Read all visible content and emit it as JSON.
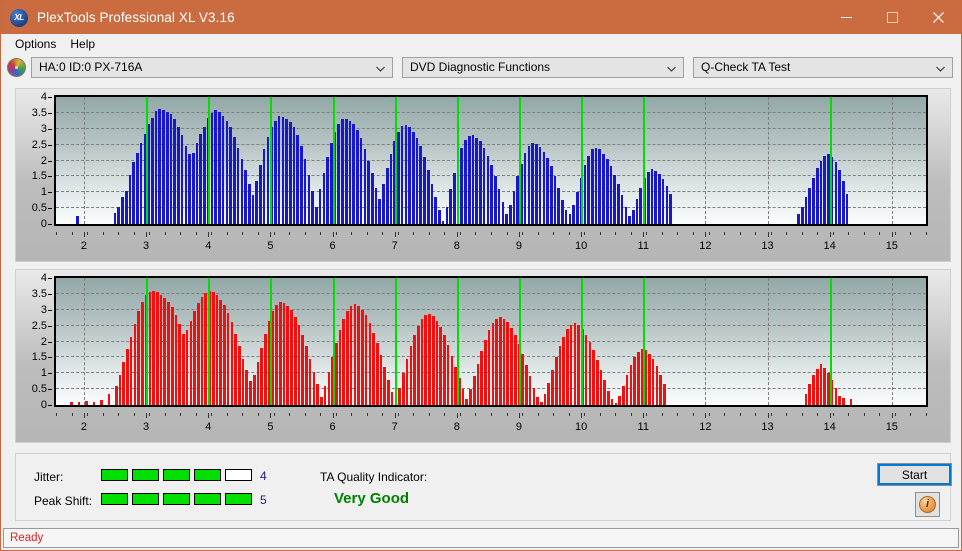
{
  "window": {
    "title": "PlexTools Professional XL V3.16",
    "icon": "xl-logo-icon",
    "minimize_label": "–",
    "maximize_label": "□",
    "close_label": "✕"
  },
  "menubar": {
    "items": [
      {
        "label": "Options"
      },
      {
        "label": "Help"
      }
    ]
  },
  "toolbar": {
    "drive_icon": "disc-icon",
    "drive": {
      "value": "HA:0 ID:0  PX-716A"
    },
    "function": {
      "value": "DVD Diagnostic Functions"
    },
    "test": {
      "value": "Q-Check TA Test"
    }
  },
  "charts": {
    "y_ticks": [
      "4",
      "3.5",
      "3",
      "2.5",
      "2",
      "1.5",
      "1",
      "0.5",
      "0"
    ],
    "x_ticks": [
      "2",
      "3",
      "4",
      "5",
      "6",
      "7",
      "8",
      "9",
      "10",
      "11",
      "12",
      "13",
      "14",
      "15"
    ]
  },
  "chart_data": [
    {
      "type": "bar",
      "name": "jitter-chart",
      "title": "",
      "xlabel": "",
      "ylabel": "",
      "color": "#1818c8",
      "marker_color": "#00e000",
      "xlim": [
        1.55,
        15.55
      ],
      "ylim": [
        0,
        4
      ],
      "grid": true,
      "yticks": [
        0,
        0.5,
        1,
        1.5,
        2,
        2.5,
        3,
        3.5,
        4
      ],
      "xticks": [
        2,
        3,
        4,
        5,
        6,
        7,
        8,
        9,
        10,
        11,
        12,
        13,
        14,
        15
      ],
      "markers": [
        3,
        4,
        5,
        6,
        7,
        8,
        9,
        10,
        11,
        14
      ],
      "x": [
        1.9,
        1.96,
        2.02,
        2.08,
        2.14,
        2.2,
        2.26,
        2.32,
        2.38,
        2.44,
        2.5,
        2.56,
        2.62,
        2.68,
        2.74,
        2.8,
        2.86,
        2.92,
        2.98,
        3.04,
        3.1,
        3.16,
        3.22,
        3.28,
        3.34,
        3.4,
        3.46,
        3.52,
        3.58,
        3.64,
        3.7,
        3.76,
        3.82,
        3.88,
        3.94,
        4.0,
        4.06,
        4.12,
        4.18,
        4.24,
        4.3,
        4.36,
        4.42,
        4.48,
        4.54,
        4.6,
        4.66,
        4.72,
        4.78,
        4.84,
        4.9,
        4.96,
        5.02,
        5.08,
        5.14,
        5.2,
        5.26,
        5.32,
        5.38,
        5.44,
        5.5,
        5.56,
        5.62,
        5.68,
        5.74,
        5.8,
        5.86,
        5.92,
        5.98,
        6.04,
        6.1,
        6.16,
        6.22,
        6.28,
        6.34,
        6.4,
        6.46,
        6.52,
        6.58,
        6.64,
        6.7,
        6.76,
        6.82,
        6.88,
        6.94,
        7.0,
        7.06,
        7.12,
        7.18,
        7.24,
        7.3,
        7.36,
        7.42,
        7.48,
        7.54,
        7.6,
        7.66,
        7.72,
        7.78,
        7.84,
        7.9,
        7.96,
        8.02,
        8.08,
        8.14,
        8.2,
        8.26,
        8.32,
        8.38,
        8.44,
        8.5,
        8.56,
        8.62,
        8.68,
        8.74,
        8.8,
        8.86,
        8.92,
        8.98,
        9.04,
        9.1,
        9.16,
        9.22,
        9.28,
        9.34,
        9.4,
        9.46,
        9.52,
        9.58,
        9.64,
        9.7,
        9.76,
        9.82,
        9.88,
        9.94,
        10.0,
        10.06,
        10.12,
        10.18,
        10.24,
        10.3,
        10.36,
        10.42,
        10.48,
        10.54,
        10.6,
        10.66,
        10.72,
        10.78,
        10.84,
        10.9,
        10.96,
        11.02,
        11.08,
        11.14,
        11.2,
        11.26,
        11.32,
        11.38,
        11.44,
        13.5,
        13.56,
        13.62,
        13.68,
        13.74,
        13.8,
        13.86,
        13.92,
        13.98,
        14.04,
        14.1,
        14.16,
        14.22,
        14.28
      ],
      "values": [
        0.25,
        0.0,
        0.0,
        0.0,
        0.0,
        0.0,
        0.0,
        0.0,
        0.0,
        0.0,
        0.35,
        0.55,
        0.85,
        1.05,
        1.55,
        1.95,
        2.25,
        2.55,
        2.85,
        3.15,
        3.35,
        3.55,
        3.62,
        3.58,
        3.52,
        3.45,
        3.3,
        3.05,
        2.8,
        2.45,
        2.2,
        2.25,
        2.55,
        2.85,
        3.05,
        3.35,
        3.5,
        3.58,
        3.52,
        3.4,
        3.25,
        3.05,
        2.75,
        2.4,
        2.05,
        1.7,
        1.25,
        0.9,
        1.35,
        1.85,
        2.35,
        2.75,
        3.05,
        3.25,
        3.4,
        3.38,
        3.3,
        3.2,
        3.05,
        2.8,
        2.45,
        2.05,
        1.55,
        1.05,
        0.55,
        1.1,
        1.6,
        2.1,
        2.55,
        2.9,
        3.15,
        3.3,
        3.32,
        3.26,
        3.15,
        2.95,
        2.7,
        2.35,
        2.0,
        1.6,
        1.15,
        0.8,
        1.25,
        1.75,
        2.2,
        2.6,
        2.9,
        3.1,
        3.12,
        3.05,
        2.9,
        2.7,
        2.45,
        2.1,
        1.7,
        1.25,
        0.85,
        0.45,
        0.1,
        0.55,
        1.1,
        1.6,
        2.05,
        2.4,
        2.65,
        2.78,
        2.8,
        2.72,
        2.6,
        2.4,
        2.15,
        1.85,
        1.5,
        1.1,
        0.7,
        0.3,
        0.6,
        1.05,
        1.5,
        1.9,
        2.25,
        2.45,
        2.55,
        2.52,
        2.42,
        2.28,
        2.08,
        1.82,
        1.5,
        1.15,
        0.75,
        0.45,
        0.3,
        0.6,
        1.0,
        1.45,
        1.85,
        2.15,
        2.35,
        2.4,
        2.35,
        2.22,
        2.05,
        1.82,
        1.55,
        1.25,
        0.9,
        0.55,
        0.25,
        0.45,
        0.8,
        1.15,
        1.45,
        1.65,
        1.72,
        1.68,
        1.58,
        1.42,
        1.2,
        0.95,
        0.3,
        0.55,
        0.85,
        1.15,
        1.45,
        1.75,
        2.0,
        2.15,
        2.2,
        2.12,
        1.95,
        1.7,
        1.35,
        0.95
      ]
    },
    {
      "type": "bar",
      "name": "peak-shift-chart",
      "title": "",
      "xlabel": "",
      "ylabel": "",
      "color": "#f01010",
      "marker_color": "#00e000",
      "xlim": [
        1.55,
        15.55
      ],
      "ylim": [
        0,
        4
      ],
      "grid": true,
      "yticks": [
        0,
        0.5,
        1,
        1.5,
        2,
        2.5,
        3,
        3.5,
        4
      ],
      "xticks": [
        2,
        3,
        4,
        5,
        6,
        7,
        8,
        9,
        10,
        11,
        12,
        13,
        14,
        15
      ],
      "markers": [
        3,
        4,
        5,
        6,
        7,
        8,
        9,
        10,
        11,
        14
      ],
      "x": [
        1.8,
        1.92,
        2.04,
        2.16,
        2.28,
        2.4,
        2.52,
        2.58,
        2.64,
        2.7,
        2.76,
        2.82,
        2.88,
        2.94,
        3.0,
        3.06,
        3.12,
        3.18,
        3.24,
        3.3,
        3.36,
        3.42,
        3.48,
        3.54,
        3.6,
        3.66,
        3.72,
        3.78,
        3.84,
        3.9,
        3.96,
        4.02,
        4.08,
        4.14,
        4.2,
        4.26,
        4.32,
        4.38,
        4.44,
        4.5,
        4.56,
        4.62,
        4.68,
        4.74,
        4.8,
        4.86,
        4.92,
        4.98,
        5.04,
        5.1,
        5.16,
        5.22,
        5.28,
        5.34,
        5.4,
        5.46,
        5.52,
        5.58,
        5.64,
        5.7,
        5.76,
        5.82,
        5.88,
        5.94,
        6.0,
        6.06,
        6.12,
        6.18,
        6.24,
        6.3,
        6.36,
        6.42,
        6.48,
        6.54,
        6.6,
        6.66,
        6.72,
        6.78,
        6.84,
        6.9,
        6.96,
        7.02,
        7.08,
        7.14,
        7.2,
        7.26,
        7.32,
        7.38,
        7.44,
        7.5,
        7.56,
        7.62,
        7.68,
        7.74,
        7.8,
        7.86,
        7.92,
        7.98,
        8.04,
        8.1,
        8.16,
        8.22,
        8.28,
        8.34,
        8.4,
        8.46,
        8.52,
        8.58,
        8.64,
        8.7,
        8.76,
        8.82,
        8.88,
        8.94,
        9.0,
        9.06,
        9.12,
        9.18,
        9.24,
        9.3,
        9.36,
        9.42,
        9.48,
        9.54,
        9.6,
        9.66,
        9.72,
        9.78,
        9.84,
        9.9,
        9.96,
        10.02,
        10.08,
        10.14,
        10.2,
        10.26,
        10.32,
        10.38,
        10.44,
        10.5,
        10.56,
        10.62,
        10.68,
        10.74,
        10.8,
        10.86,
        10.92,
        10.98,
        11.04,
        11.1,
        11.16,
        11.22,
        11.28,
        11.34,
        13.62,
        13.68,
        13.74,
        13.8,
        13.86,
        13.92,
        13.98,
        14.04,
        14.1,
        14.16,
        14.22,
        14.34
      ],
      "values": [
        0.1,
        0.08,
        0.12,
        0.08,
        0.15,
        0.35,
        0.6,
        0.95,
        1.35,
        1.75,
        2.15,
        2.55,
        2.95,
        3.25,
        3.45,
        3.55,
        3.6,
        3.55,
        3.48,
        3.38,
        3.25,
        3.08,
        2.85,
        2.55,
        2.25,
        2.35,
        2.65,
        2.95,
        3.2,
        3.4,
        3.52,
        3.58,
        3.55,
        3.45,
        3.32,
        3.15,
        2.9,
        2.6,
        2.25,
        1.85,
        1.45,
        1.1,
        0.75,
        0.95,
        1.35,
        1.8,
        2.25,
        2.65,
        2.95,
        3.15,
        3.25,
        3.22,
        3.12,
        2.98,
        2.78,
        2.52,
        2.2,
        1.85,
        1.45,
        1.05,
        0.65,
        0.25,
        0.6,
        1.05,
        1.5,
        1.95,
        2.35,
        2.7,
        2.95,
        3.12,
        3.18,
        3.12,
        3.0,
        2.82,
        2.58,
        2.28,
        1.95,
        1.58,
        1.2,
        0.8,
        0.4,
        0.15,
        0.55,
        1.0,
        1.45,
        1.85,
        2.2,
        2.5,
        2.72,
        2.85,
        2.88,
        2.8,
        2.65,
        2.45,
        2.2,
        1.9,
        1.55,
        1.2,
        0.85,
        0.5,
        0.2,
        0.5,
        0.9,
        1.3,
        1.7,
        2.05,
        2.35,
        2.58,
        2.72,
        2.78,
        2.72,
        2.6,
        2.42,
        2.2,
        1.92,
        1.6,
        1.25,
        0.9,
        0.55,
        0.25,
        0.08,
        0.35,
        0.7,
        1.1,
        1.5,
        1.85,
        2.15,
        2.38,
        2.52,
        2.58,
        2.52,
        2.4,
        2.22,
        2.0,
        1.72,
        1.42,
        1.1,
        0.78,
        0.45,
        0.18,
        0.05,
        0.28,
        0.6,
        0.95,
        1.25,
        1.5,
        1.68,
        1.75,
        1.72,
        1.62,
        1.45,
        1.22,
        0.95,
        0.65,
        0.35,
        0.65,
        0.95,
        1.15,
        1.28,
        1.18,
        1.0,
        0.8,
        0.55,
        0.28,
        0.22,
        0.18
      ]
    }
  ],
  "status": {
    "jitter_label": "Jitter:",
    "jitter_value": "4",
    "jitter_segments": [
      true,
      true,
      true,
      true,
      false
    ],
    "peakshift_label": "Peak Shift:",
    "peakshift_value": "5",
    "peakshift_segments": [
      true,
      true,
      true,
      true,
      true
    ],
    "ta_label": "TA Quality Indicator:",
    "ta_value": "Very Good",
    "ta_color": "#008000",
    "start_label": "Start",
    "info_label": "i"
  },
  "statusbar": {
    "text": "Ready"
  }
}
